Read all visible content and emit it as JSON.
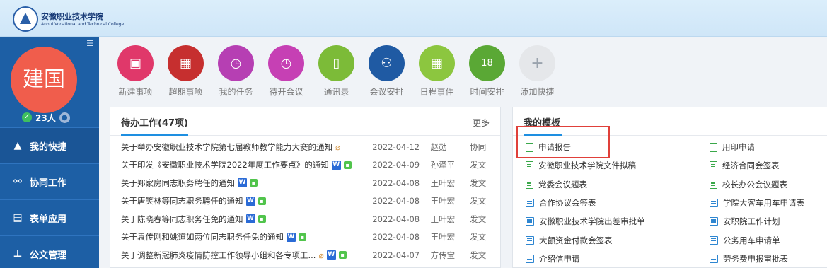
{
  "header": {
    "school_name": "安徽职业技术学院",
    "school_name_en": "Anhui Vocational and Technical College"
  },
  "user": {
    "avatar_text": "建国",
    "online_count": "23人"
  },
  "nav": [
    {
      "label": "我的快捷",
      "icon": "triangle-icon"
    },
    {
      "label": "协同工作",
      "icon": "share-icon"
    },
    {
      "label": "表单应用",
      "icon": "table-icon"
    },
    {
      "label": "公文管理",
      "icon": "stamp-icon"
    }
  ],
  "quick": [
    {
      "label": "新建事项",
      "color": "#e0386a",
      "icon": "new-item-icon"
    },
    {
      "label": "超期事项",
      "color": "#c62f2f",
      "icon": "overdue-icon"
    },
    {
      "label": "我的任务",
      "color": "#b63fb3",
      "icon": "task-icon"
    },
    {
      "label": "待开会议",
      "color": "#c640b4",
      "icon": "meeting-icon"
    },
    {
      "label": "通讯录",
      "color": "#7cbb38",
      "icon": "contacts-icon"
    },
    {
      "label": "会议安排",
      "color": "#1f5aa3",
      "icon": "meeting-plan-icon"
    },
    {
      "label": "日程事件",
      "color": "#8cc63f",
      "icon": "calendar-icon"
    },
    {
      "label": "时间安排",
      "color": "#5aa835",
      "icon": "calendar-18-icon"
    },
    {
      "label": "添加快捷",
      "color": "#e5e7ea",
      "icon": "plus-icon"
    }
  ],
  "todo": {
    "title": "待办工作(47项)",
    "more": "更多",
    "rows": [
      {
        "title": "关于举办安徽职业技术学院第七届教师教学能力大赛的通知",
        "date": "2022-04-12",
        "person": "赵勋",
        "type": "协同",
        "attach": true,
        "word": false,
        "wx": false
      },
      {
        "title": "关于印发《安徽职业技术学院2022年度工作要点》的通知",
        "date": "2022-04-09",
        "person": "孙泽平",
        "type": "发文",
        "attach": false,
        "word": true,
        "wx": true
      },
      {
        "title": "关于郑家房同志职务聘任的通知",
        "date": "2022-04-08",
        "person": "王叶宏",
        "type": "发文",
        "attach": false,
        "word": true,
        "wx": true
      },
      {
        "title": "关于唐笑林等同志职务聘任的通知",
        "date": "2022-04-08",
        "person": "王叶宏",
        "type": "发文",
        "attach": false,
        "word": true,
        "wx": true
      },
      {
        "title": "关于陈晓春等同志职务任免的通知",
        "date": "2022-04-08",
        "person": "王叶宏",
        "type": "发文",
        "attach": false,
        "word": true,
        "wx": true
      },
      {
        "title": "关于袁传刚和姚道如两位同志职务任免的通知",
        "date": "2022-04-08",
        "person": "王叶宏",
        "type": "发文",
        "attach": false,
        "word": true,
        "wx": true
      },
      {
        "title": "关于调整新冠肺炎疫情防控工作领导小组和各专项工...",
        "date": "2022-04-07",
        "person": "方传宝",
        "type": "发文",
        "attach": true,
        "word": true,
        "wx": true
      }
    ]
  },
  "templates": {
    "title": "我的模板",
    "items": [
      {
        "label": "申请报告",
        "icon": "doc"
      },
      {
        "label": "用印申请",
        "icon": "doc"
      },
      {
        "label": "安徽职业技术学院文件拟稿",
        "icon": "doc"
      },
      {
        "label": "经济合同会签表",
        "icon": "doc"
      },
      {
        "label": "党委会议题表",
        "icon": "doc"
      },
      {
        "label": "校长办公会议题表",
        "icon": "doc"
      },
      {
        "label": "合作协议会签表",
        "icon": "form"
      },
      {
        "label": "学院大客车用车申请表",
        "icon": "form"
      },
      {
        "label": "安徽职业技术学院出差审批单",
        "icon": "form"
      },
      {
        "label": "安职院工作计划",
        "icon": "form"
      },
      {
        "label": "大额资金付款会签表",
        "icon": "form"
      },
      {
        "label": "公务用车申请单",
        "icon": "form"
      },
      {
        "label": "介绍信申请",
        "icon": "form"
      },
      {
        "label": "劳务费申报审批表",
        "icon": "form"
      }
    ]
  }
}
